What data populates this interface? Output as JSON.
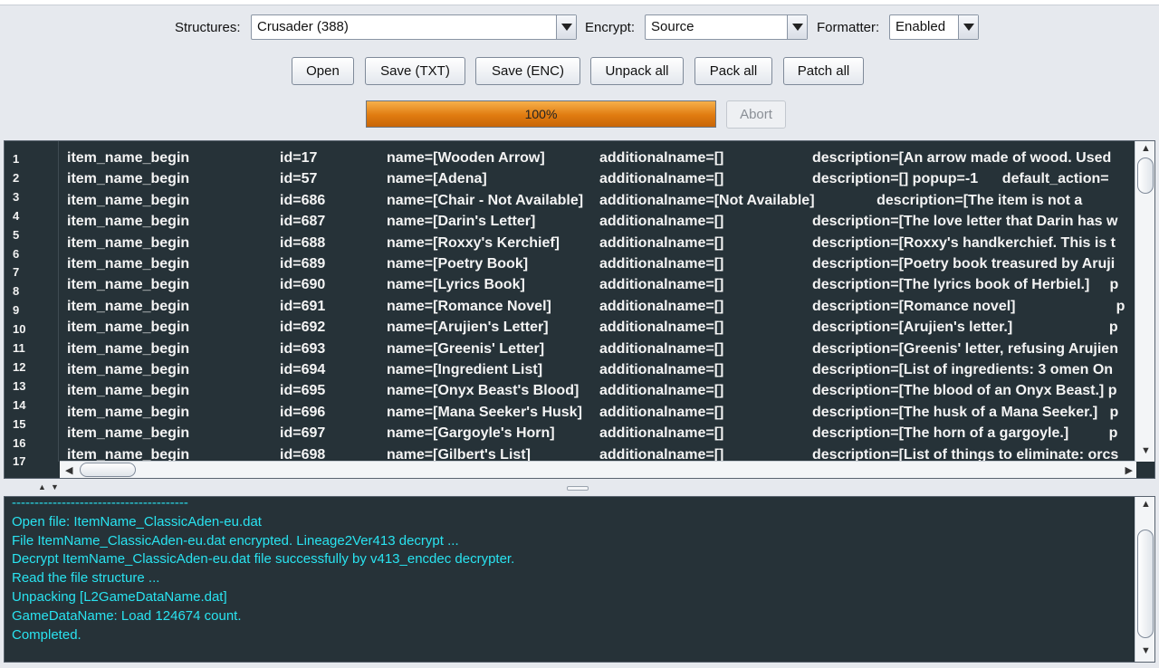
{
  "toolbar": {
    "structures_label": "Structures:",
    "structures_value": "Crusader (388)",
    "encrypt_label": "Encrypt:",
    "encrypt_value": "Source",
    "formatter_label": "Formatter:",
    "formatter_value": "Enabled"
  },
  "buttons": {
    "open": "Open",
    "save_txt": "Save (TXT)",
    "save_enc": "Save (ENC)",
    "unpack_all": "Unpack all",
    "pack_all": "Pack all",
    "patch_all": "Patch all",
    "abort": "Abort"
  },
  "progress": {
    "value": 100,
    "label": "100%"
  },
  "editor": {
    "line_numbers": [
      "1",
      "2",
      "3",
      "4",
      "5",
      "6",
      "7",
      "8",
      "9",
      "10",
      "11",
      "12",
      "13",
      "14",
      "15",
      "16",
      "17"
    ],
    "rows": [
      {
        "c1": "item_name_begin",
        "c2": "id=17",
        "c3": "name=[Wooden Arrow]",
        "c4": "additionalname=[]",
        "c5": "description=[An arrow made of wood. Used"
      },
      {
        "c1": "item_name_begin",
        "c2": "id=57",
        "c3": "name=[Adena]",
        "c4": "additionalname=[]",
        "c5": "description=[] popup=-1      default_action="
      },
      {
        "c1": "item_name_begin",
        "c2": "id=686",
        "c3": "name=[Chair - Not Available]",
        "c4": "additionalname=[Not Available]",
        "c5": "                description=[The item is not a"
      },
      {
        "c1": "item_name_begin",
        "c2": "id=687",
        "c3": "name=[Darin's Letter]",
        "c4": "additionalname=[]",
        "c5": "description=[The love letter that Darin has w"
      },
      {
        "c1": "item_name_begin",
        "c2": "id=688",
        "c3": "name=[Roxxy's Kerchief]",
        "c4": "additionalname=[]",
        "c5": "description=[Roxxy's handkerchief. This is t"
      },
      {
        "c1": "item_name_begin",
        "c2": "id=689",
        "c3": "name=[Poetry Book]",
        "c4": "additionalname=[]",
        "c5": "description=[Poetry book treasured by Aruji"
      },
      {
        "c1": "item_name_begin",
        "c2": "id=690",
        "c3": "name=[Lyrics Book]",
        "c4": "additionalname=[]",
        "c5": "description=[The lyrics book of Herbiel.]     p"
      },
      {
        "c1": "item_name_begin",
        "c2": "id=691",
        "c3": "name=[Romance Novel]",
        "c4": "additionalname=[]",
        "c5": "description=[Romance novel]                         p"
      },
      {
        "c1": "item_name_begin",
        "c2": "id=692",
        "c3": "name=[Arujien's Letter]",
        "c4": "additionalname=[]",
        "c5": "description=[Arujien's letter.]                        p"
      },
      {
        "c1": "item_name_begin",
        "c2": "id=693",
        "c3": "name=[Greenis' Letter]",
        "c4": "additionalname=[]",
        "c5": "description=[Greenis' letter, refusing Arujien"
      },
      {
        "c1": "item_name_begin",
        "c2": "id=694",
        "c3": "name=[Ingredient List]",
        "c4": "additionalname=[]",
        "c5": "description=[List of ingredients: 3 omen On"
      },
      {
        "c1": "item_name_begin",
        "c2": "id=695",
        "c3": "name=[Onyx Beast's Blood]",
        "c4": "additionalname=[]",
        "c5": "description=[The blood of an Onyx Beast.] p"
      },
      {
        "c1": "item_name_begin",
        "c2": "id=696",
        "c3": "name=[Mana Seeker's Husk]",
        "c4": "additionalname=[]",
        "c5": "description=[The husk of a Mana Seeker.]   p"
      },
      {
        "c1": "item_name_begin",
        "c2": "id=697",
        "c3": "name=[Gargoyle's Horn]",
        "c4": "additionalname=[]",
        "c5": "description=[The horn of a gargoyle.]          p"
      },
      {
        "c1": "item_name_begin",
        "c2": "id=698",
        "c3": "name=[Gilbert's List]",
        "c4": "additionalname=[]",
        "c5": "description=[List of things to eliminate: orcs"
      }
    ]
  },
  "console": {
    "lines": [
      "---------------------------------------",
      "Open file: ItemName_ClassicAden-eu.dat",
      "File ItemName_ClassicAden-eu.dat encrypted. Lineage2Ver413 decrypt ...",
      "Decrypt ItemName_ClassicAden-eu.dat file successfully by v413_encdec decrypter.",
      "Read the file structure ...",
      "Unpacking [L2GameDataName.dat]",
      "GameDataName: Load 124674 count.",
      "Completed."
    ]
  },
  "colors": {
    "editor_bg": "#263238",
    "console_text": "#29e3f0",
    "progress_fill": "#e07b10"
  }
}
